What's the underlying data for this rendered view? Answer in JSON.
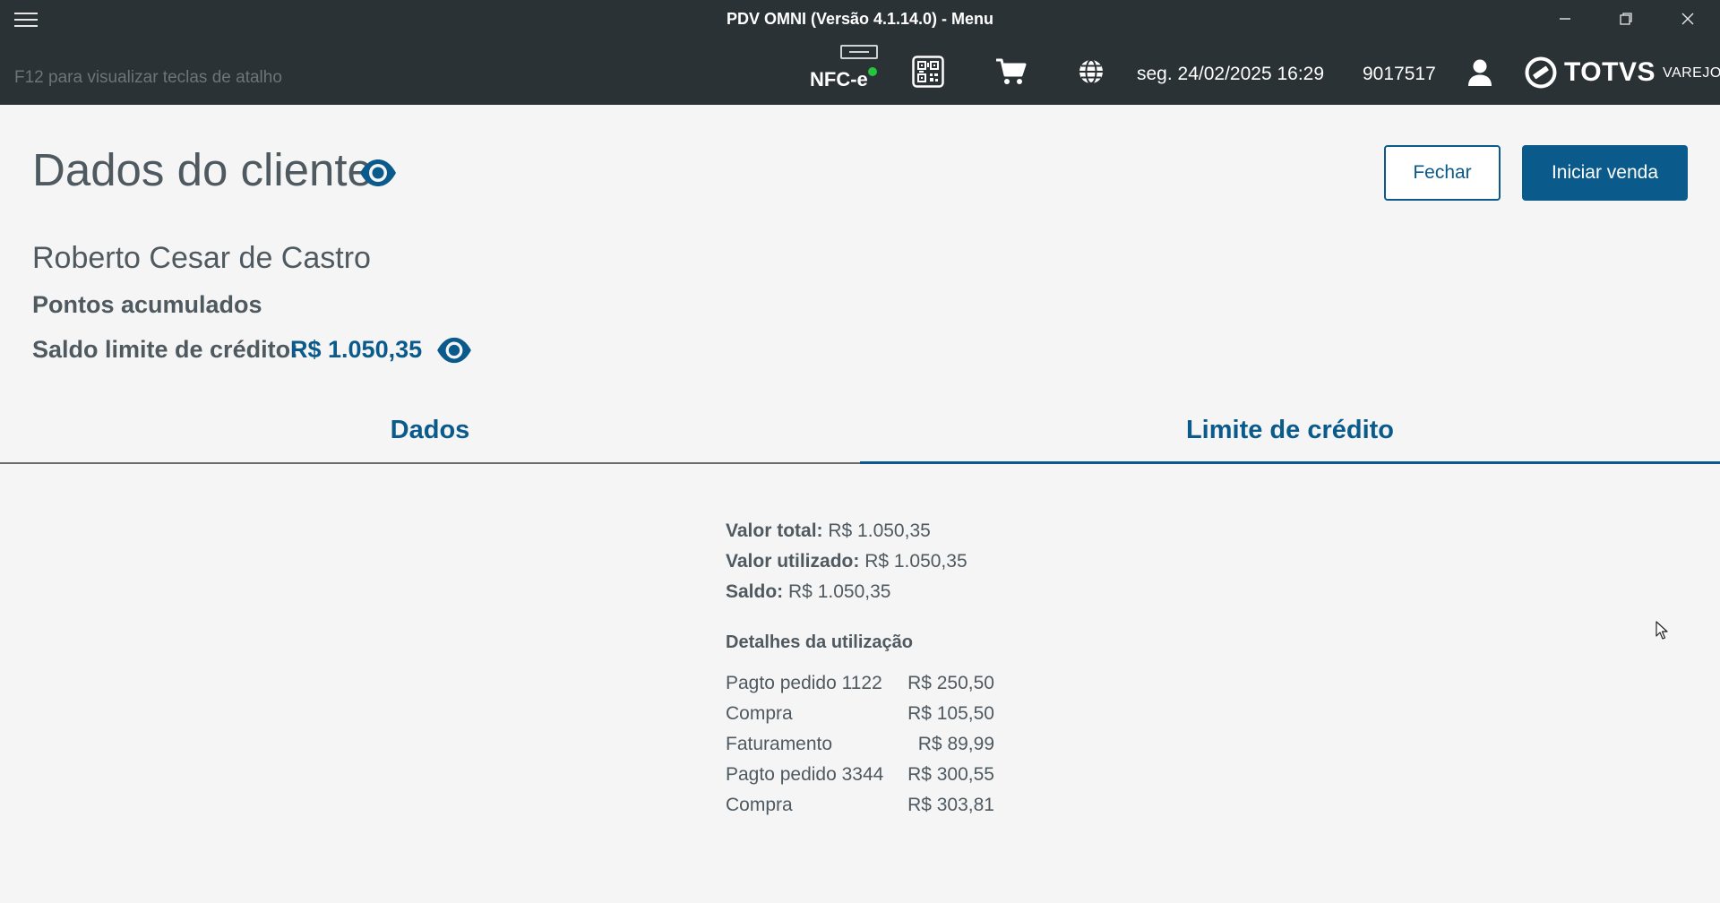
{
  "window": {
    "title": "PDV OMNI (Versão 4.1.14.0) - Menu"
  },
  "header": {
    "shortcut_hint": "F12 para visualizar teclas de atalho",
    "nfce_label": "NFC-e",
    "nfce_status_color": "#25c43d",
    "datetime": "seg. 24/02/2025 16:29",
    "user_code": "9017517",
    "brand_name": "TOTVS",
    "brand_sub": "VAREJO"
  },
  "page": {
    "title": "Dados do cliente",
    "buttons": {
      "close": "Fechar",
      "start_sale": "Iniciar venda"
    }
  },
  "customer": {
    "name": "Roberto Cesar de Castro",
    "points_label": "Pontos acumulados",
    "credit_label": "Saldo limite de crédito:",
    "credit_value": "R$ 1.050,35"
  },
  "tabs": [
    {
      "label": "Dados",
      "active": false
    },
    {
      "label": "Limite de crédito",
      "active": true
    }
  ],
  "credit": {
    "total_label": "Valor total:",
    "total_value": "R$ 1.050,35",
    "used_label": "Valor utilizado:",
    "used_value": "R$ 1.050,35",
    "balance_label": "Saldo:",
    "balance_value": "R$ 1.050,35",
    "details_title": "Detalhes da utilização",
    "details": [
      {
        "label": "Pagto pedido 1122",
        "value": "R$ 250,50"
      },
      {
        "label": "Compra",
        "value": "R$ 105,50"
      },
      {
        "label": "Faturamento",
        "value": "R$ 89,99"
      },
      {
        "label": "Pagto pedido 3344",
        "value": "R$ 300,55"
      },
      {
        "label": "Compra",
        "value": "R$ 303,81"
      }
    ]
  },
  "colors": {
    "bar_bg": "#2a3236",
    "accent": "#0b5a8c",
    "page_bg": "#f5f5f5"
  }
}
